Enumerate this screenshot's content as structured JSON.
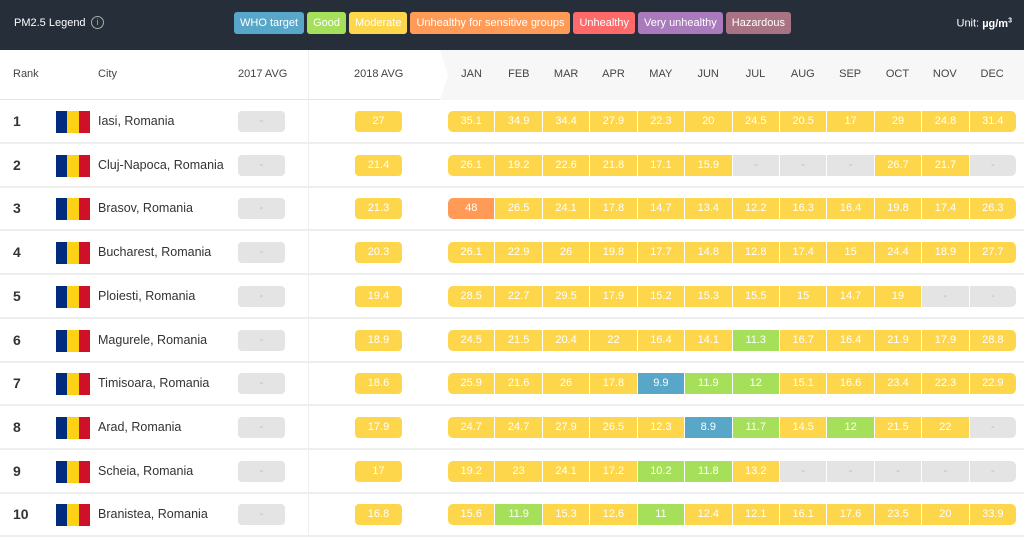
{
  "legend": {
    "title": "PM2.5 Legend",
    "info_icon": "info-icon",
    "unit_label": "Unit:",
    "unit": "µg/m",
    "unit_sup": "3",
    "categories": [
      {
        "label": "WHO target",
        "color": "#58a6c8"
      },
      {
        "label": "Good",
        "color": "#a6e05a"
      },
      {
        "label": "Moderate",
        "color": "#fdd64b"
      },
      {
        "label": "Unhealthy for sensitive groups",
        "color": "#ff9b57"
      },
      {
        "label": "Unhealthy",
        "color": "#fe6a69"
      },
      {
        "label": "Very unhealthy",
        "color": "#a97abc"
      },
      {
        "label": "Hazardous",
        "color": "#a87383"
      }
    ]
  },
  "headers": {
    "rank": "Rank",
    "city": "City",
    "avg2017": "2017 AVG",
    "avg2018": "2018 AVG",
    "months": [
      "JAN",
      "FEB",
      "MAR",
      "APR",
      "MAY",
      "JUN",
      "JUL",
      "AUG",
      "SEP",
      "OCT",
      "NOV",
      "DEC"
    ]
  },
  "flag_colors": [
    "#002b7f",
    "#fcd116",
    "#ce1126"
  ],
  "rows": [
    {
      "rank": "1",
      "city": "Iasi, Romania",
      "avg2017": "-",
      "avg2018": "27",
      "months": [
        "35.1",
        "34.9",
        "34.4",
        "27.9",
        "22.3",
        "20",
        "24.5",
        "20.5",
        "17",
        "29",
        "24.8",
        "31.4"
      ]
    },
    {
      "rank": "2",
      "city": "Cluj-Napoca, Romania",
      "avg2017": "-",
      "avg2018": "21.4",
      "months": [
        "26.1",
        "19.2",
        "22.6",
        "21.8",
        "17.1",
        "15.9",
        "-",
        "-",
        "-",
        "26.7",
        "21.7",
        "-"
      ]
    },
    {
      "rank": "3",
      "city": "Brasov, Romania",
      "avg2017": "-",
      "avg2018": "21.3",
      "months": [
        "48",
        "26.5",
        "24.1",
        "17.8",
        "14.7",
        "13.4",
        "12.2",
        "16.3",
        "16.4",
        "19.8",
        "17.4",
        "26.3"
      ]
    },
    {
      "rank": "4",
      "city": "Bucharest, Romania",
      "avg2017": "-",
      "avg2018": "20.3",
      "months": [
        "26.1",
        "22.9",
        "26",
        "19.8",
        "17.7",
        "14.8",
        "12.8",
        "17.4",
        "15",
        "24.4",
        "18.9",
        "27.7"
      ]
    },
    {
      "rank": "5",
      "city": "Ploiesti, Romania",
      "avg2017": "-",
      "avg2018": "19.4",
      "months": [
        "28.5",
        "22.7",
        "29.5",
        "17.9",
        "15.2",
        "15.3",
        "15.5",
        "15",
        "14.7",
        "19",
        "-",
        "-"
      ]
    },
    {
      "rank": "6",
      "city": "Magurele, Romania",
      "avg2017": "-",
      "avg2018": "18.9",
      "months": [
        "24.5",
        "21.5",
        "20.4",
        "22",
        "16.4",
        "14.1",
        "11.3",
        "16.7",
        "16.4",
        "21.9",
        "17.9",
        "28.8"
      ]
    },
    {
      "rank": "7",
      "city": "Timisoara, Romania",
      "avg2017": "-",
      "avg2018": "18.6",
      "months": [
        "25.9",
        "21.6",
        "26",
        "17.8",
        "9.9",
        "11.9",
        "12",
        "15.1",
        "16.6",
        "23.4",
        "22.3",
        "22.9"
      ]
    },
    {
      "rank": "8",
      "city": "Arad, Romania",
      "avg2017": "-",
      "avg2018": "17.9",
      "months": [
        "24.7",
        "24.7",
        "27.9",
        "26.5",
        "12.3",
        "8.9",
        "11.7",
        "14.5",
        "12",
        "21.5",
        "22",
        "-"
      ]
    },
    {
      "rank": "9",
      "city": "Scheia, Romania",
      "avg2017": "-",
      "avg2018": "17",
      "months": [
        "19.2",
        "23",
        "24.1",
        "17.2",
        "10.2",
        "11.8",
        "13.2",
        "-",
        "-",
        "-",
        "-",
        "-"
      ]
    },
    {
      "rank": "10",
      "city": "Branistea, Romania",
      "avg2017": "-",
      "avg2018": "16.8",
      "months": [
        "15.6",
        "11.9",
        "15.3",
        "12.6",
        "11",
        "12.4",
        "12.1",
        "16.1",
        "17.6",
        "23.5",
        "20",
        "33.9"
      ]
    }
  ]
}
